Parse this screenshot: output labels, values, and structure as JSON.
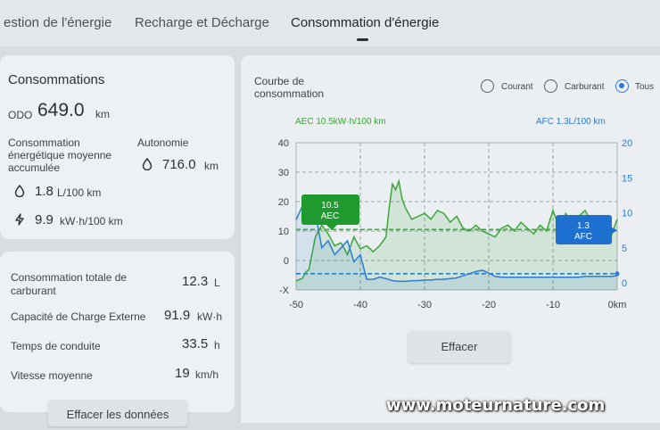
{
  "tabs": [
    {
      "label": "estion de l'énergie"
    },
    {
      "label": "Recharge et Décharge"
    },
    {
      "label": "Consommation d'énergie",
      "active": true
    }
  ],
  "consumption_card": {
    "title": "Consommations",
    "odo_label": "ODO",
    "odo_value": "649.0",
    "odo_unit": "km",
    "avg_label_l1": "Consommation",
    "avg_label_l2": "énergétique moyenne",
    "avg_label_l3": "accumulée",
    "autonomy_label": "Autonomie",
    "autonomy_value": "716.0",
    "autonomy_unit": "km",
    "fuel_value": "1.8",
    "fuel_unit": "L/100 km",
    "elec_value": "9.9",
    "elec_unit": "kW·h/100 km"
  },
  "stats_card": {
    "rows": [
      {
        "label_l1": "Consommation totale de",
        "label_l2": "carburant",
        "value": "12.3",
        "unit": "L"
      },
      {
        "label_l1": "Capacité de Charge Externe",
        "label_l2": "",
        "value": "91.9",
        "unit": "kW·h"
      },
      {
        "label_l1": "Temps de conduite",
        "label_l2": "",
        "value": "33.5",
        "unit": "h"
      },
      {
        "label_l1": "Vitesse moyenne",
        "label_l2": "",
        "value": "19",
        "unit": "km/h"
      }
    ],
    "clear_data_label": "Effacer les données"
  },
  "chart_panel": {
    "title_l1": "Courbe de",
    "title_l2": "consommation",
    "options": [
      {
        "label": "Courant",
        "selected": false
      },
      {
        "label": "Carburant",
        "selected": false
      },
      {
        "label": "Tous",
        "selected": true
      }
    ],
    "clear_label": "Effacer"
  },
  "colors": {
    "electric": "#3aa63a",
    "fuel": "#2b7cd3",
    "aec_badge": "#1e9a2e",
    "afc_badge": "#1d6fd0"
  },
  "chart_data": {
    "type": "line",
    "aec_legend": "AEC  10.5kW·h/100 km",
    "afc_legend": "AFC  1.3L/100 km",
    "aec_badge_l1": "10.5",
    "aec_badge_l2": "AEC",
    "afc_badge_l1": "1.3",
    "afc_badge_l2": "AFC",
    "x_ticks": [
      "-50",
      "-40",
      "-30",
      "-20",
      "-10",
      "0km"
    ],
    "y_left_ticks": [
      "40",
      "30",
      "20",
      "10",
      "0",
      "-X"
    ],
    "y_right_ticks": [
      "20",
      "15",
      "10",
      "5",
      "0"
    ],
    "xlim": [
      -50,
      0
    ],
    "ylim_left": [
      -10,
      40
    ],
    "ylim_right": [
      0,
      20
    ],
    "aec_average": 10.5,
    "afc_average": 1.3,
    "series": [
      {
        "axis": "left",
        "x": [
          -50,
          -49,
          -48.5,
          -48,
          -47,
          -46,
          -45,
          -44,
          -43,
          -42,
          -41,
          -40,
          -39,
          -38,
          -37,
          -36,
          -35.5,
          -35,
          -34.5,
          -34,
          -33.5,
          -33,
          -32,
          -31,
          -30,
          -29,
          -28,
          -27,
          -26,
          -25,
          -24,
          -23,
          -22,
          -21,
          -20,
          -19,
          -18,
          -17,
          -16,
          -15,
          -14,
          -13,
          -12,
          -11,
          -10,
          -9,
          -8,
          -7,
          -6,
          -5,
          -4,
          -3,
          -2,
          -1,
          0
        ],
        "values": [
          -7,
          -6,
          -4,
          -3,
          8,
          12,
          9,
          5,
          6,
          2,
          8,
          4,
          5,
          3,
          5,
          8,
          18,
          26,
          24,
          27,
          21,
          18,
          14,
          15,
          16,
          14,
          17,
          16,
          13,
          15,
          11,
          10,
          12,
          10,
          9,
          8,
          11,
          12,
          10,
          13,
          11,
          9,
          12,
          10,
          17,
          11,
          16,
          12,
          15,
          17,
          13,
          10,
          9,
          8,
          14
        ]
      },
      {
        "axis": "right",
        "x": [
          -50,
          -49,
          -48,
          -47,
          -46,
          -45,
          -44,
          -43,
          -42,
          -41,
          -40,
          -39,
          -38,
          -37,
          -36,
          -35,
          -34,
          -33,
          -32,
          -31,
          -30,
          -29,
          -28,
          -27,
          -26,
          -25,
          -24,
          -23,
          -22,
          -21,
          -20,
          -19,
          -18,
          -17,
          -16,
          -15,
          -14,
          -13,
          -12,
          -11,
          -10,
          -9,
          -8,
          -7,
          -6,
          -5,
          -4,
          -3,
          -2,
          -1,
          0
        ],
        "values": [
          9,
          11,
          12,
          10,
          5,
          6,
          4,
          5,
          6,
          3,
          4,
          0.5,
          0.5,
          0.8,
          0.6,
          0.3,
          0.2,
          0.2,
          0.3,
          0.3,
          0.4,
          0.4,
          0.5,
          0.5,
          0.6,
          0.7,
          1.0,
          1.3,
          1.6,
          1.8,
          1.4,
          0.9,
          0.8,
          0.8,
          0.8,
          0.8,
          0.8,
          0.8,
          0.8,
          0.8,
          0.8,
          0.8,
          0.8,
          0.8,
          0.8,
          0.9,
          0.9,
          0.9,
          0.9,
          0.9,
          1.0
        ]
      }
    ]
  },
  "watermark": "www.moteurnature.com"
}
